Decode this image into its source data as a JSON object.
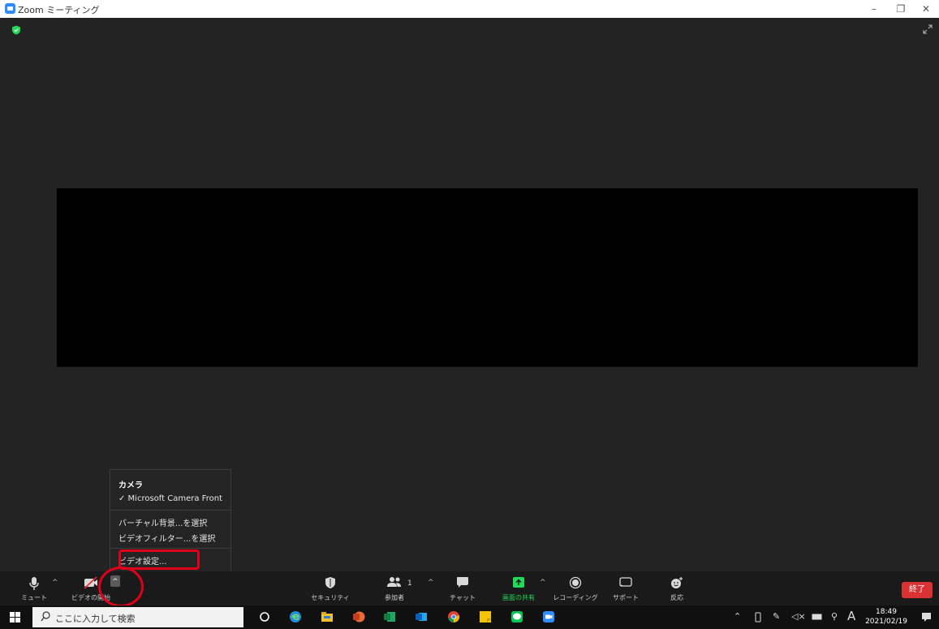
{
  "window": {
    "title": "Zoom ミーティング",
    "minimize": "–",
    "restore": "❐",
    "close": "✕"
  },
  "colors": {
    "zoom_blue": "#2D8CFF",
    "highlight_red": "#e0001b",
    "end_red": "#d83234",
    "share_green": "#23d959"
  },
  "camera_menu": {
    "header": "カメラ",
    "camera_item": "✓ Microsoft Camera Front",
    "virtual_bg": "バーチャル背景...を選択",
    "video_filter": "ビデオフィルター...を選択",
    "video_settings": "ビデオ設定..."
  },
  "toolbar": {
    "mute": "ミュート",
    "start_video": "ビデオの開始",
    "security": "セキュリティ",
    "participants": "参加者",
    "participant_count": "1",
    "chat": "チャット",
    "share_screen": "画面の共有",
    "recording": "レコーディング",
    "support": "サポート",
    "reactions": "反応",
    "end": "終了",
    "caret": "^"
  },
  "taskbar": {
    "search_placeholder": "ここに入力して検索",
    "time": "18:49",
    "date": "2021/02/19",
    "ime": "A"
  }
}
